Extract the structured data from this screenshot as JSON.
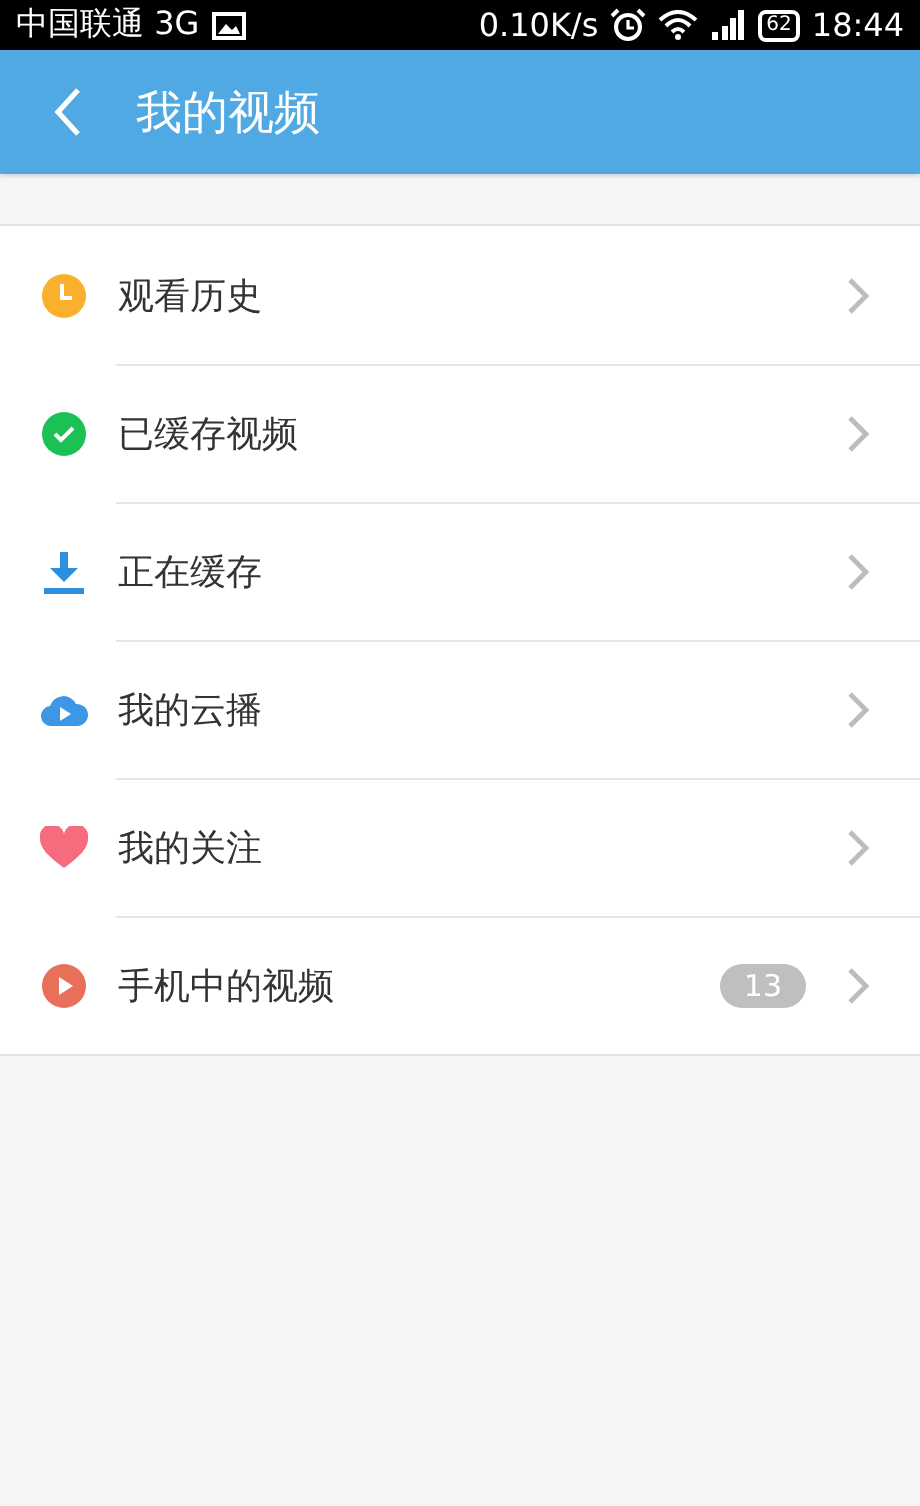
{
  "status_bar": {
    "carrier": "中国联通 3G",
    "speed": "0.10K/s",
    "battery": "62",
    "time": "18:44"
  },
  "header": {
    "title": "我的视频"
  },
  "items": [
    {
      "kind": "history",
      "label": "观看历史"
    },
    {
      "kind": "cached",
      "label": "已缓存视频"
    },
    {
      "kind": "downloading",
      "label": "正在缓存"
    },
    {
      "kind": "cloud",
      "label": "我的云播"
    },
    {
      "kind": "follow",
      "label": "我的关注"
    },
    {
      "kind": "local",
      "label": "手机中的视频",
      "badge": "13"
    }
  ]
}
